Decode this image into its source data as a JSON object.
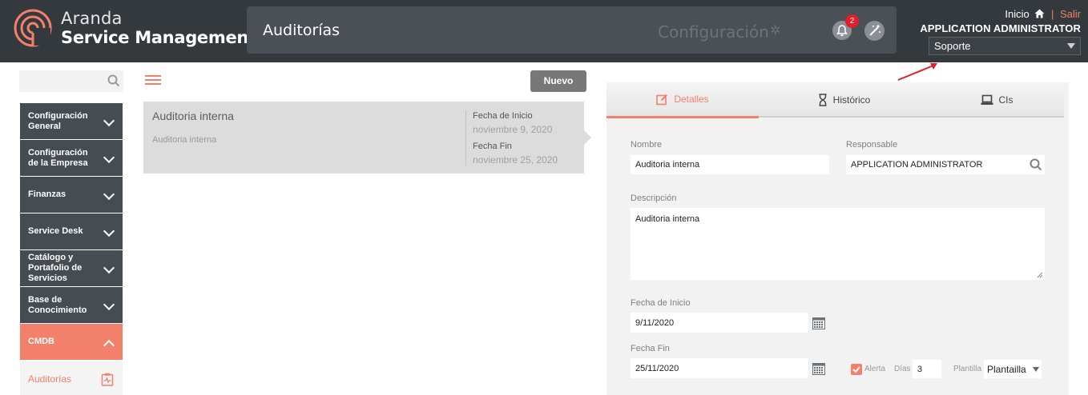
{
  "header": {
    "brand_line1": "Aranda",
    "brand_line2": "Service Management",
    "page_title": "Auditorías",
    "config_label": "Configuración",
    "notification_count": "2",
    "home_label": "Inicio",
    "separator": "|",
    "logout_label": "Salir",
    "user_name": "APPLICATION ADMINISTRATOR",
    "role_selected": "Soporte"
  },
  "sidebar": {
    "search_placeholder": "",
    "items": [
      {
        "label": "Configuración General"
      },
      {
        "label": "Configuración de la Empresa"
      },
      {
        "label": "Finanzas"
      },
      {
        "label": "Service Desk"
      },
      {
        "label": "Catálogo y Portafolio de Servicios"
      },
      {
        "label": "Base de Conocimiento"
      },
      {
        "label": "CMDB"
      }
    ],
    "subitems": [
      {
        "label": "Auditorías"
      }
    ]
  },
  "list": {
    "new_button": "Nuevo",
    "record": {
      "title": "Auditoria interna",
      "subtitle": "Auditoria interna",
      "start_label": "Fecha de Inicio",
      "start_value": "noviembre 9, 2020",
      "end_label": "Fecha Fin",
      "end_value": "noviembre 25, 2020"
    }
  },
  "detail": {
    "tabs": [
      {
        "label": "Detalles"
      },
      {
        "label": "Histórico"
      },
      {
        "label": "CIs"
      }
    ],
    "name_label": "Nombre",
    "name_value": "Auditoria interna",
    "owner_label": "Responsable",
    "owner_value": "APPLICATION ADMINISTRATOR",
    "desc_label": "Descripción",
    "desc_value": "Auditoria interna",
    "start_label": "Fecha de Inicio",
    "start_value": "9/11/2020",
    "end_label": "Fecha Fin",
    "end_value": "25/11/2020",
    "alert_label": "Alerta",
    "days_label": "Días",
    "days_value": "3",
    "template_label": "Plantilla",
    "template_value": "Plantailla"
  },
  "colors": {
    "accent": "#f2806b",
    "header_bg": "#34393d",
    "menu_bg": "#454c52",
    "badge": "#e0202a",
    "annotation_arrow": "#e0202a"
  }
}
